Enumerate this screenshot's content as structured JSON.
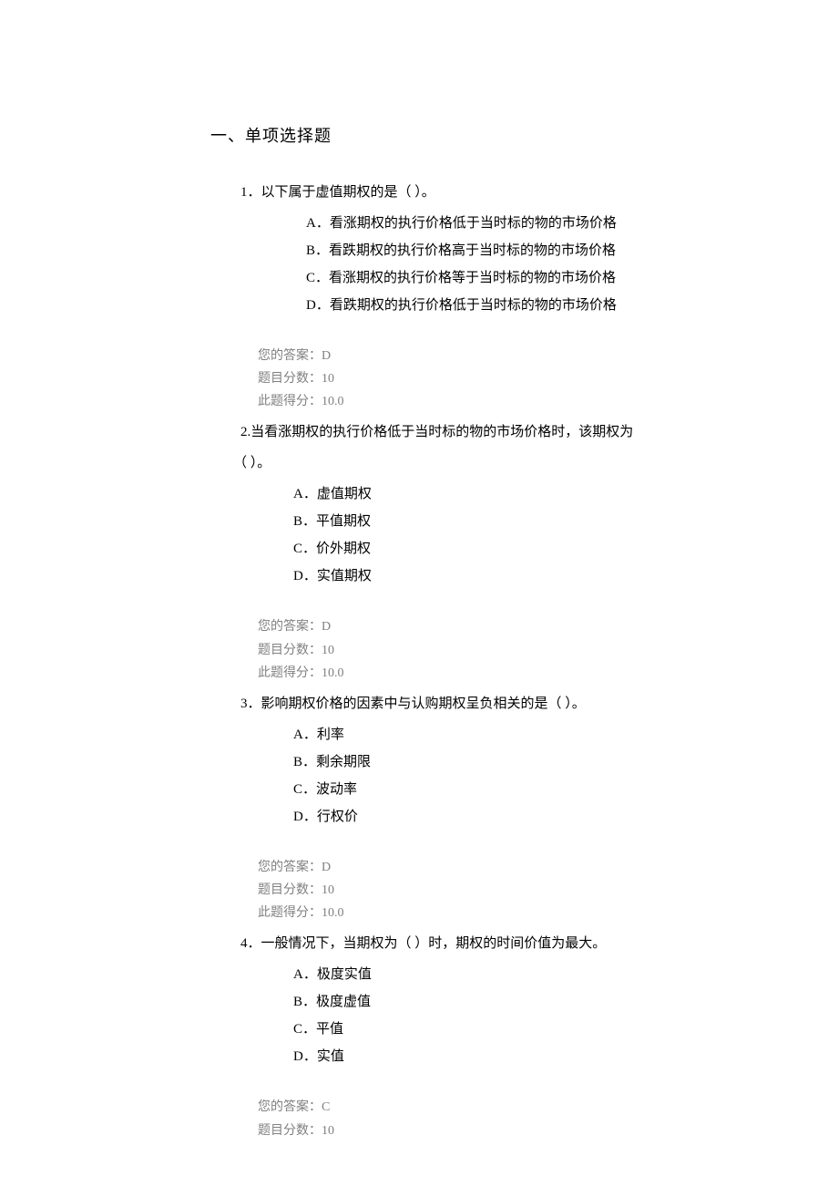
{
  "section_title": "一、单项选择题",
  "questions": [
    {
      "stem": "1．以下属于虚值期权的是（ ）。",
      "options": [
        "A．看涨期权的执行价格低于当时标的物的市场价格",
        "B．看跌期权的执行价格高于当时标的物的市场价格",
        "C．看涨期权的执行价格等于当时标的物的市场价格",
        "D．看跌期权的执行价格低于当时标的物的市场价格"
      ],
      "answer_label": "您的答案：D",
      "points_label": "题目分数：10",
      "score_label": "此题得分：10.0"
    },
    {
      "stem": "2.当看涨期权的执行价格低于当时标的物的市场价格时，该期权为",
      "stem_cont": "（ ）。",
      "options": [
        "A．虚值期权",
        "B．平值期权",
        "C．价外期权",
        "D．实值期权"
      ],
      "answer_label": "您的答案：D",
      "points_label": "题目分数：10",
      "score_label": "此题得分：10.0"
    },
    {
      "stem": "3．影响期权价格的因素中与认购期权呈负相关的是（ ）。",
      "options": [
        "A．利率",
        "B．剩余期限",
        "C．波动率",
        "D．行权价"
      ],
      "answer_label": "您的答案：D",
      "points_label": "题目分数：10",
      "score_label": "此题得分：10.0"
    },
    {
      "stem": "4．一般情况下，当期权为（ ）时，期权的时间价值为最大。",
      "options": [
        "A．极度实值",
        "B．极度虚值",
        "C．平值",
        "D．实值"
      ],
      "answer_label": "您的答案：C",
      "points_label": "题目分数：10"
    }
  ]
}
